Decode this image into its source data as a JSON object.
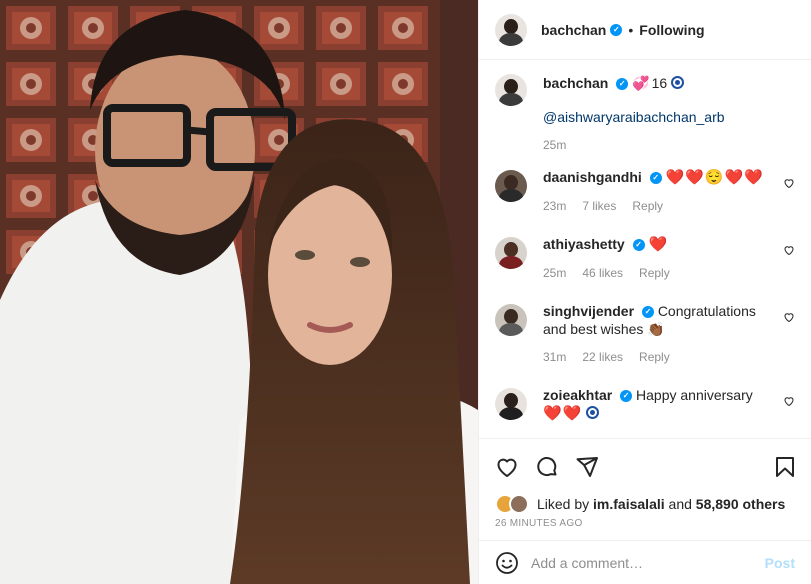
{
  "photo": {
    "description_icon": "photo"
  },
  "header": {
    "username": "bachchan",
    "separator": "•",
    "follow_status": "Following"
  },
  "caption": {
    "username": "bachchan",
    "emoji": "💞",
    "text": "16",
    "mention": "@aishwaryaraibachchan_arb",
    "time": "25m"
  },
  "comments": [
    {
      "username": "daanishgandhi",
      "text": "❤️❤️😌❤️❤️",
      "time": "23m",
      "likes": "7 likes",
      "reply": "Reply"
    },
    {
      "username": "athiyashetty",
      "text": "❤️",
      "time": "25m",
      "likes": "46 likes",
      "reply": "Reply"
    },
    {
      "username": "singhvijender",
      "text": "Congratulations and best wishes 👏🏾",
      "time": "31m",
      "likes": "22 likes",
      "reply": "Reply"
    },
    {
      "username": "zoieakhtar",
      "text": "Happy anniversary",
      "text2": "❤️❤️",
      "time": "",
      "likes": "",
      "reply": ""
    }
  ],
  "likes": {
    "prefix": "Liked by",
    "user": "im.faisalali",
    "conj": "and",
    "others": "58,890 others"
  },
  "timestamp": "26 MINUTES AGO",
  "add_comment": {
    "placeholder": "Add a comment…",
    "post_label": "Post"
  },
  "colors": {
    "accent": "#0095f6",
    "mention": "#00376b",
    "muted": "#8e8e8e",
    "post_disabled": "#b2dffc"
  }
}
